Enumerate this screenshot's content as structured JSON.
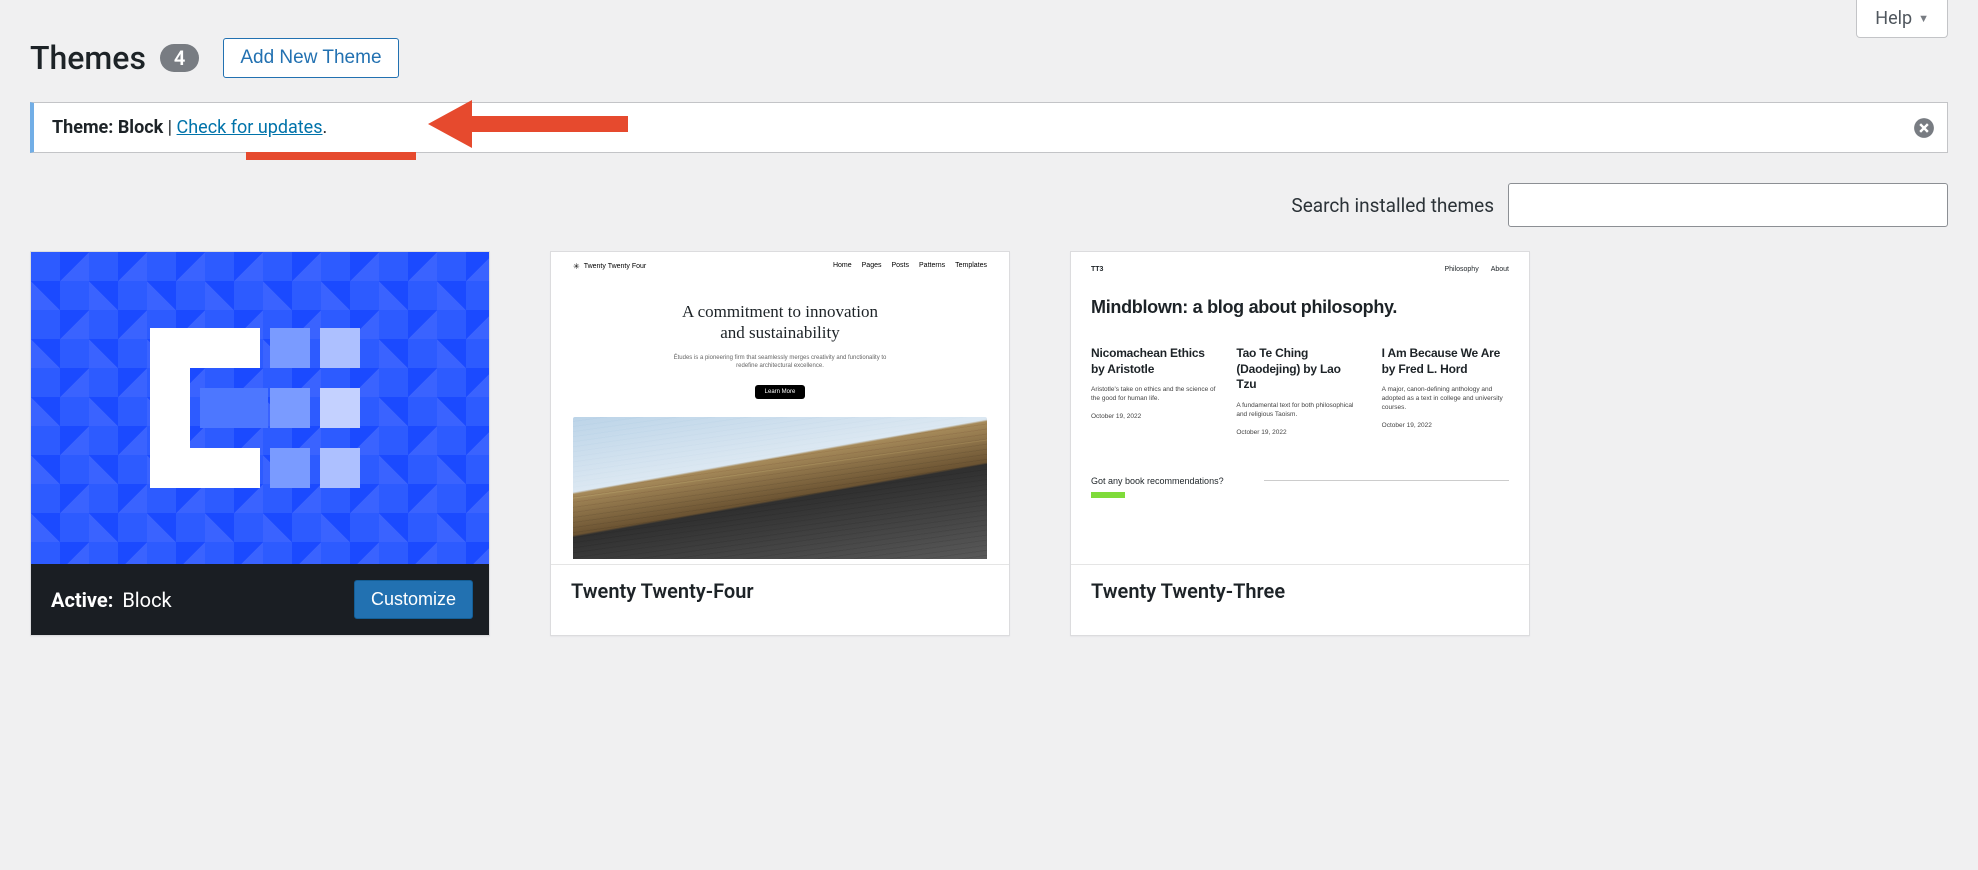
{
  "help_label": "Help",
  "page_title": "Themes",
  "theme_count": "4",
  "add_new_label": "Add New Theme",
  "notice": {
    "prefix": "Theme: Block",
    "separator": " | ",
    "link_text": "Check for updates",
    "suffix": "."
  },
  "search_label": "Search installed themes",
  "themes": [
    {
      "active": true,
      "active_prefix": "Active:",
      "name": "Block",
      "customize_label": "Customize"
    },
    {
      "active": false,
      "name": "Twenty Twenty-Four"
    },
    {
      "active": false,
      "name": "Twenty Twenty-Three"
    }
  ],
  "t24": {
    "brand": "Twenty Twenty Four",
    "nav": [
      "Home",
      "Pages",
      "Posts",
      "Patterns",
      "Templates"
    ],
    "heading_l1": "A commitment to innovation",
    "heading_l2": "and sustainability",
    "sub": "Études is a pioneering firm that seamlessly merges creativity and functionality to redefine architectural excellence.",
    "cta": "Learn More"
  },
  "t23": {
    "brand": "TT3",
    "nav": [
      "Philosophy",
      "About"
    ],
    "title": "Mindblown: a blog about philosophy.",
    "cols": [
      {
        "h": "Nicomachean Ethics by Aristotle",
        "p": "Aristotle's take on ethics and the science of the good for human life.",
        "d": "October 19, 2022"
      },
      {
        "h": "Tao Te Ching (Daodejing) by Lao Tzu",
        "p": "A fundamental text for both philosophical and religious Taoism.",
        "d": "October 19, 2022"
      },
      {
        "h": "I Am Because We Are by Fred L. Hord",
        "p": "A major, canon-defining anthology and adopted as a text in college and university courses.",
        "d": "October 19, 2022"
      }
    ],
    "q": "Got any book recommendations?"
  }
}
